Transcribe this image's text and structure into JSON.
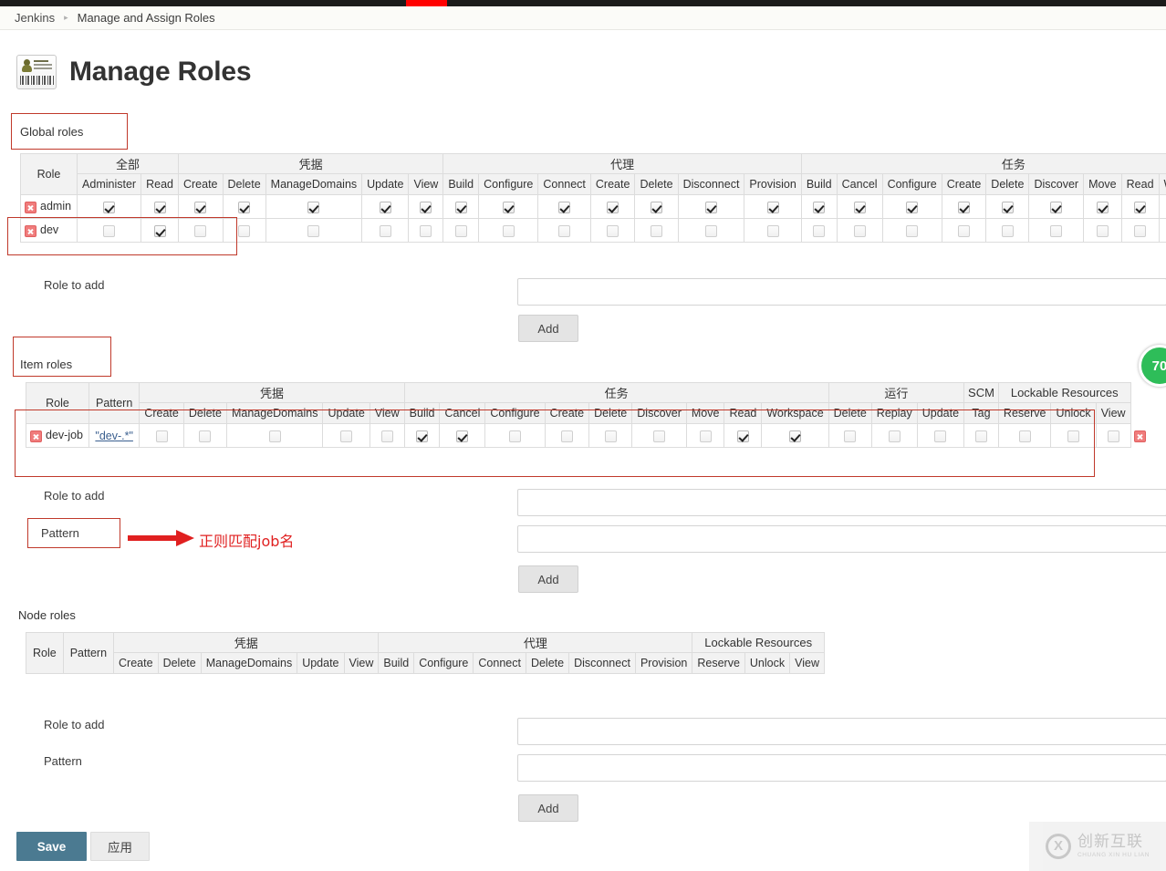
{
  "breadcrumb": {
    "root": "Jenkins",
    "separator": "▸",
    "current": "Manage and Assign Roles"
  },
  "page": {
    "title": "Manage Roles",
    "icon": "id-badge-icon"
  },
  "sections": {
    "global": {
      "label": "Global roles",
      "columns": {
        "role_header": "Role",
        "groups": [
          {
            "name": "全部",
            "items": [
              "Administer",
              "Read"
            ]
          },
          {
            "name": "凭据",
            "items": [
              "Create",
              "Delete",
              "ManageDomains",
              "Update",
              "View"
            ]
          },
          {
            "name": "代理",
            "items": [
              "Build",
              "Configure",
              "Connect",
              "Create",
              "Delete",
              "Disconnect",
              "Provision"
            ]
          },
          {
            "name": "任务",
            "items": [
              "Build",
              "Cancel",
              "Configure",
              "Create",
              "Delete",
              "Discover",
              "Move",
              "Read",
              "Workspace"
            ]
          }
        ]
      },
      "rows": [
        {
          "role": "admin",
          "checks": [
            true,
            true,
            true,
            true,
            true,
            true,
            true,
            true,
            true,
            true,
            true,
            true,
            true,
            true,
            true,
            true,
            true,
            true,
            true,
            true,
            true,
            true,
            true
          ]
        },
        {
          "role": "dev",
          "checks": [
            false,
            true,
            false,
            false,
            false,
            false,
            false,
            false,
            false,
            false,
            false,
            false,
            false,
            false,
            false,
            false,
            false,
            false,
            false,
            false,
            false,
            false,
            false
          ]
        }
      ],
      "role_to_add_label": "Role to add",
      "role_to_add_value": "",
      "add_label": "Add"
    },
    "item": {
      "label": "Item roles",
      "columns": {
        "role_header": "Role",
        "pattern_header": "Pattern",
        "groups": [
          {
            "name": "凭据",
            "items": [
              "Create",
              "Delete",
              "ManageDomains",
              "Update",
              "View"
            ]
          },
          {
            "name": "任务",
            "items": [
              "Build",
              "Cancel",
              "Configure",
              "Create",
              "Delete",
              "Discover",
              "Move",
              "Read",
              "Workspace"
            ]
          },
          {
            "name": "运行",
            "items": [
              "Delete",
              "Replay",
              "Update"
            ]
          },
          {
            "name": "SCM",
            "items": [
              "Tag"
            ]
          },
          {
            "name": "Lockable Resources",
            "items": [
              "Reserve",
              "Unlock",
              "View"
            ]
          }
        ]
      },
      "rows": [
        {
          "role": "dev-job",
          "pattern": "\"dev-.*\"",
          "checks": [
            false,
            false,
            false,
            false,
            false,
            true,
            true,
            false,
            false,
            false,
            false,
            false,
            true,
            true,
            false,
            false,
            false,
            false,
            false,
            false,
            false
          ]
        }
      ],
      "role_to_add_label": "Role to add",
      "role_to_add_value": "",
      "pattern_label": "Pattern",
      "pattern_value": "",
      "add_label": "Add"
    },
    "node": {
      "label": "Node roles",
      "columns": {
        "role_header": "Role",
        "pattern_header": "Pattern",
        "groups": [
          {
            "name": "凭据",
            "items": [
              "Create",
              "Delete",
              "ManageDomains",
              "Update",
              "View"
            ]
          },
          {
            "name": "代理",
            "items": [
              "Build",
              "Configure",
              "Connect",
              "Delete",
              "Disconnect",
              "Provision"
            ]
          },
          {
            "name": "Lockable Resources",
            "items": [
              "Reserve",
              "Unlock",
              "View"
            ]
          }
        ]
      },
      "rows": [],
      "role_to_add_label": "Role to add",
      "role_to_add_value": "",
      "pattern_label": "Pattern",
      "pattern_value": "",
      "add_label": "Add"
    }
  },
  "footer": {
    "save_label": "Save",
    "apply_label": "应用"
  },
  "annotation": {
    "text": "正则匹配job名",
    "color": "#e02020"
  },
  "score_badge": {
    "value": "70",
    "color": "#2ebd59"
  },
  "watermark": {
    "cn": "创新互联",
    "en": "CHUANG XIN HU LIAN"
  },
  "colors": {
    "accent": "#4b7a91",
    "annotation_red": "#c0392b",
    "topbar": "#1b1b1b",
    "topbar_accent": "#ff0000"
  }
}
